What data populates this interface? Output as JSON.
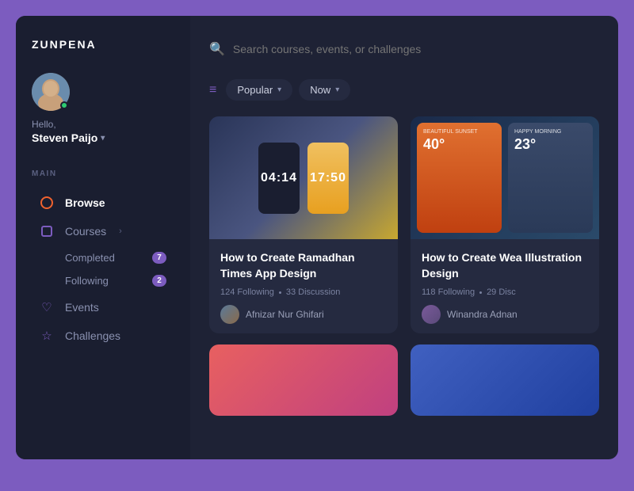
{
  "app": {
    "logo": "ZUNPENA"
  },
  "user": {
    "greeting": "Hello,",
    "name": "Steven Paijo",
    "chevron": "▾",
    "online": true
  },
  "sidebar": {
    "section_label": "MAIN",
    "nav_items": [
      {
        "id": "browse",
        "label": "Browse",
        "icon": "circle",
        "active": true
      },
      {
        "id": "courses",
        "label": "Courses",
        "icon": "square",
        "active": false,
        "arrow": "›"
      },
      {
        "id": "events",
        "label": "Events",
        "icon": "heart",
        "active": false
      },
      {
        "id": "challenges",
        "label": "Challenges",
        "icon": "star",
        "active": false
      }
    ],
    "sub_items": [
      {
        "label": "Completed",
        "badge": "7"
      },
      {
        "label": "Following",
        "badge": "2"
      }
    ]
  },
  "search": {
    "placeholder": "Search courses, events, or challenges"
  },
  "filters": [
    {
      "label": "Popular",
      "id": "popular"
    },
    {
      "label": "Now",
      "id": "now"
    }
  ],
  "cards": [
    {
      "id": "card-1",
      "title": "How to Create Ramadhan Times App Design",
      "time1": "04:14",
      "time2": "17:50",
      "following": "124 Following",
      "discussion": "33 Discussion",
      "author": "Afnizar Nur Ghifari"
    },
    {
      "id": "card-2",
      "title": "How to Create Wea Illustration Design",
      "temp1": "40°",
      "temp2": "23°",
      "following": "118 Following",
      "discussion": "29 Disc",
      "author": "Winandra Adnan"
    }
  ]
}
